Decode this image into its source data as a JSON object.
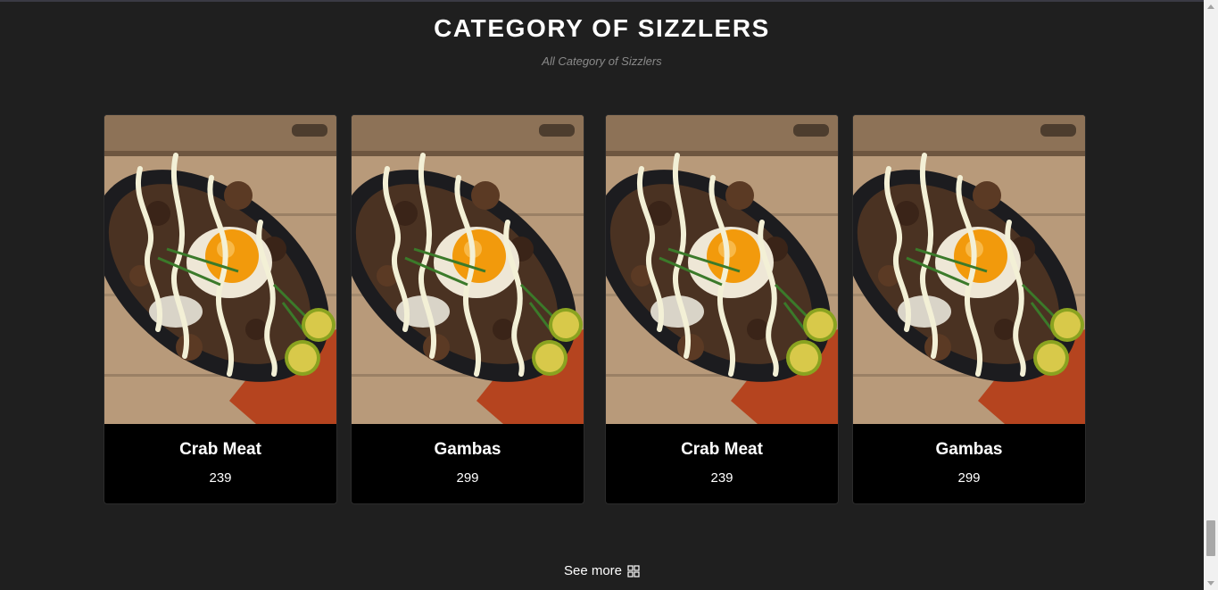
{
  "section": {
    "title": "CATEGORY OF SIZZLERS",
    "subtitle": "All Category of Sizzlers"
  },
  "cards": [
    {
      "name": "Crab Meat",
      "price": "239"
    },
    {
      "name": "Gambas",
      "price": "299"
    },
    {
      "name": "Crab Meat",
      "price": "239"
    },
    {
      "name": "Gambas",
      "price": "299"
    }
  ],
  "see_more": {
    "label": "See more",
    "icon": "grid-icon"
  },
  "colors": {
    "background": "#1f1f1f",
    "card": "#000000",
    "subtitle": "#8a8a8a"
  }
}
